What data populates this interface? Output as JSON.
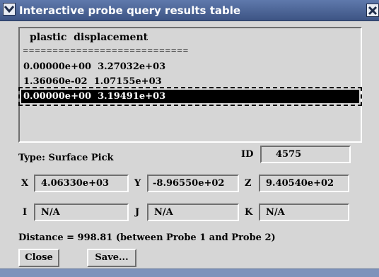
{
  "window": {
    "title": "Interactive probe query results table"
  },
  "results": {
    "header": "plastic  displacement",
    "separator": "============================",
    "rows": [
      "0.00000e+00  3.27032e+03",
      "1.36060e-02  1.07155e+03",
      "0.00000e+00  3.19491e+03"
    ],
    "selected_row": 2
  },
  "info": {
    "type_label": "Type: Surface Pick",
    "id_label": "ID",
    "id_value": "4575"
  },
  "coords": {
    "x_label": "X",
    "x_value": "4.06330e+03",
    "y_label": "Y",
    "y_value": "-8.96550e+02",
    "z_label": "Z",
    "z_value": "9.40540e+02"
  },
  "indices": {
    "i_label": "I",
    "i_value": "N/A",
    "j_label": "J",
    "j_value": "N/A",
    "k_label": "K",
    "k_value": "N/A"
  },
  "distance_text": "Distance = 998.81 (between Probe 1 and Probe 2)",
  "buttons": {
    "close_label": "Close",
    "save_label": "Save..."
  },
  "colors": {
    "titlebar": "#4a6294",
    "window_bg": "#d6d6d6",
    "selection": "#000000"
  },
  "icons": {
    "window_menu": "chevron-down-icon",
    "window_close": "close-icon"
  }
}
